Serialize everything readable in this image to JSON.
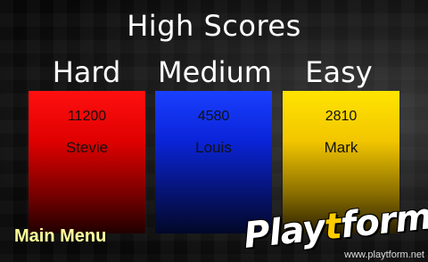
{
  "screen_title": "High Scores",
  "columns": [
    {
      "difficulty": "Hard",
      "score": "11200",
      "player": "Stevie",
      "color": "#e00000"
    },
    {
      "difficulty": "Medium",
      "score": "4580",
      "player": "Louis",
      "color": "#0a24d8"
    },
    {
      "difficulty": "Easy",
      "score": "2810",
      "player": "Mark",
      "color": "#f2c600"
    }
  ],
  "main_menu_label": "Main Menu",
  "watermark": {
    "text_a": "Play",
    "text_b": "t",
    "text_c": "form",
    "url": "www.playtform.net"
  }
}
